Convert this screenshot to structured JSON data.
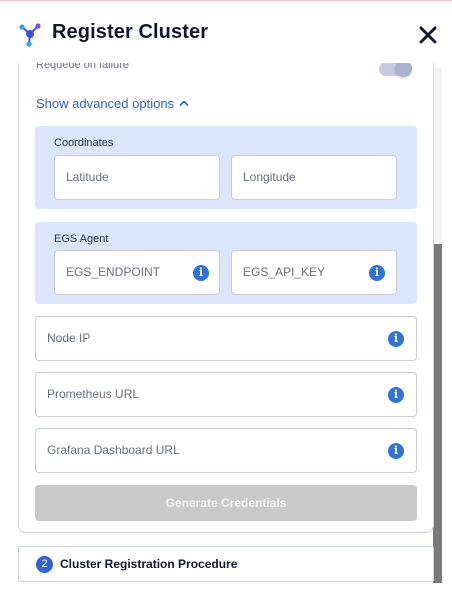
{
  "header": {
    "title": "Register Cluster",
    "logo_icon": "cluster-network-icon",
    "close_icon": "close-icon"
  },
  "form": {
    "requeue_label": "Requeue on failure",
    "advanced_toggle_label": "Show advanced options",
    "coordinates": {
      "label": "Coordinates",
      "latitude_placeholder": "Latitude",
      "longitude_placeholder": "Longitude"
    },
    "egs_agent": {
      "label": "EGS Agent",
      "endpoint_placeholder": "EGS_ENDPOINT",
      "api_key_placeholder": "EGS_API_KEY"
    },
    "node_ip_placeholder": "Node IP",
    "prometheus_url_placeholder": "Prometheus URL",
    "grafana_url_placeholder": "Grafana Dashboard URL",
    "info_glyph": "i",
    "generate_button_label": "Generate Credentials"
  },
  "steps": [
    {
      "number": "2",
      "label": "Cluster Registration Procedure"
    }
  ],
  "colors": {
    "accent": "#2f62d6",
    "info": "#2e73d9",
    "group_bg": "#dbe5fb",
    "button_disabled": "#c9c9c9"
  }
}
